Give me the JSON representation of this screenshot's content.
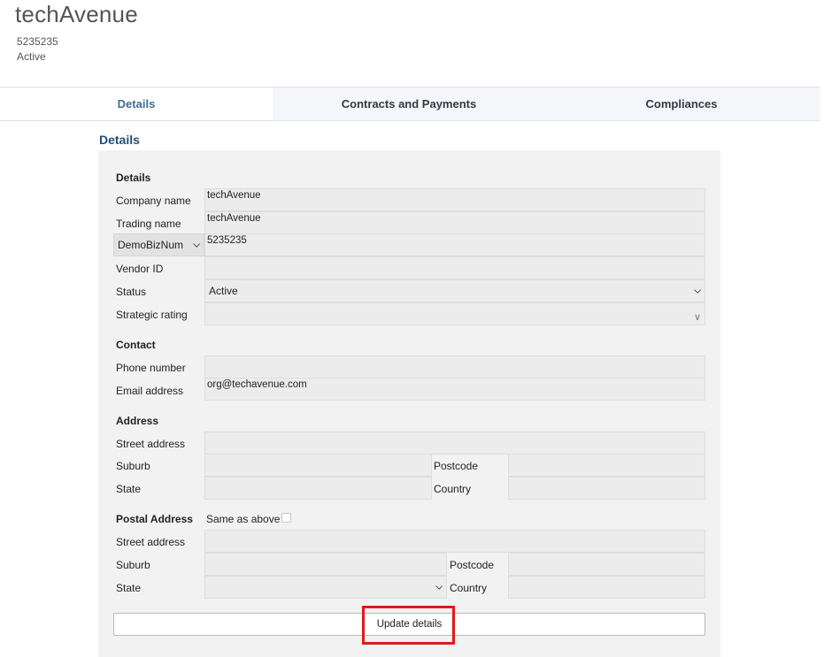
{
  "header": {
    "title": "techAvenue",
    "number": "5235235",
    "status": "Active"
  },
  "tabs": [
    {
      "label": "Details",
      "active": true
    },
    {
      "label": "Contracts and Payments",
      "active": false
    },
    {
      "label": "Compliances",
      "active": false
    }
  ],
  "section_heading": "Details",
  "details": {
    "title": "Details",
    "company_name_label": "Company name",
    "company_name_value": "techAvenue",
    "trading_name_label": "Trading name",
    "trading_name_value": "techAvenue",
    "id_type_selected": "DemoBizNum",
    "id_value": "5235235",
    "vendor_id_label": "Vendor ID",
    "vendor_id_value": "",
    "status_label": "Status",
    "status_value": "Active",
    "strategic_rating_label": "Strategic rating",
    "strategic_rating_value": ""
  },
  "contact": {
    "title": "Contact",
    "phone_label": "Phone number",
    "phone_value": "",
    "email_label": "Email address",
    "email_value": "org@techavenue.com"
  },
  "address": {
    "title": "Address",
    "street_label": "Street address",
    "suburb_label": "Suburb",
    "postcode_label": "Postcode",
    "state_label": "State",
    "country_label": "Country"
  },
  "postal_address": {
    "title": "Postal Address",
    "same_as_above_label": "Same as above",
    "same_as_above_checked": false,
    "street_label": "Street address",
    "suburb_label": "Suburb",
    "postcode_label": "Postcode",
    "state_label": "State",
    "country_label": "Country"
  },
  "actions": {
    "update_label": "Update details"
  },
  "colors": {
    "active_tab_text": "#3a6e9a",
    "heading": "#1f4e79",
    "highlight_box": "#e01a1a"
  },
  "icons": {
    "dropdown": "chevron-down-icon"
  }
}
